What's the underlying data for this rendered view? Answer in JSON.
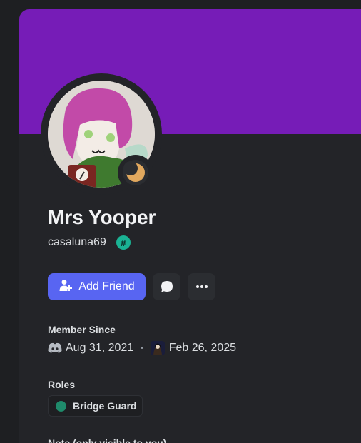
{
  "profile": {
    "display_name": "Mrs Yooper",
    "username": "casaluna69",
    "tag_symbol": "#"
  },
  "actions": {
    "add_friend_label": "Add Friend"
  },
  "member_since": {
    "label": "Member Since",
    "discord_date": "Aug 31, 2021",
    "separator": "•",
    "server_date": "Feb 26, 2025"
  },
  "roles": {
    "label": "Roles",
    "items": [
      {
        "name": "Bridge Guard",
        "color": "#1f8b6b"
      }
    ]
  },
  "note": {
    "label": "Note (only visible to you)"
  },
  "colors": {
    "banner": "#761cb7",
    "card": "#232428",
    "accent": "#5865f2",
    "status_idle": "#f0b232"
  },
  "icons": {
    "status": "idle-moon-icon",
    "add_friend": "add-friend-icon",
    "message": "chat-bubble-icon",
    "more": "more-icon",
    "discord": "discord-icon",
    "server": "server-icon"
  }
}
